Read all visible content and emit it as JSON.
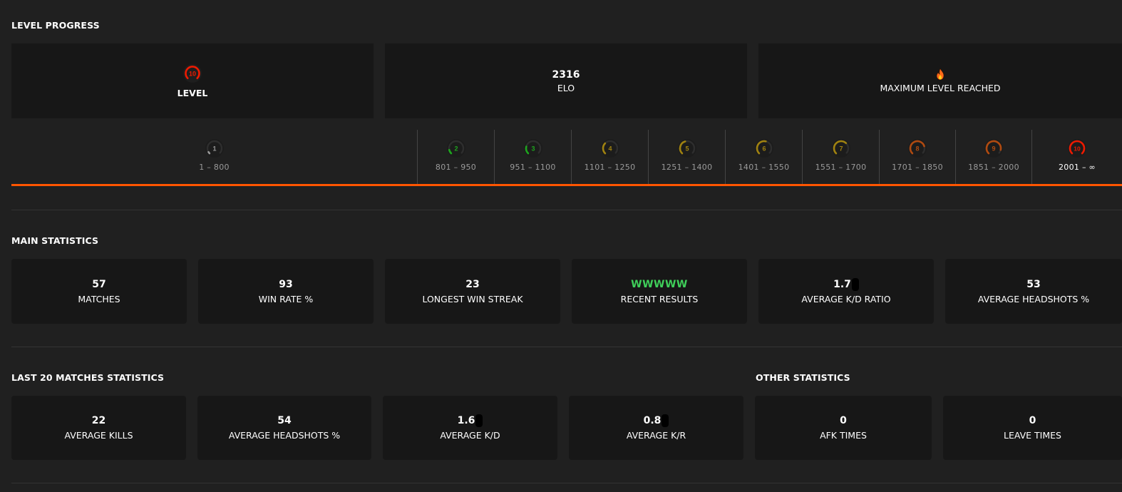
{
  "level_progress": {
    "title": "LEVEL PROGRESS",
    "level_card": {
      "level": "10",
      "label": "LEVEL"
    },
    "elo_card": {
      "value": "2316",
      "label": "ELO"
    },
    "max_card": {
      "icon": "fire-icon",
      "label": "MAXIMUM LEVEL REACHED"
    },
    "progress_fraction": 1.0,
    "accent_color": "#ff5500",
    "levels": [
      {
        "level": "1",
        "range": "1 – 800",
        "color": "#9a9a9a",
        "fill": 0.05
      },
      {
        "level": "2",
        "range": "801 – 950",
        "color": "#1ea51e",
        "fill": 0.12
      },
      {
        "level": "3",
        "range": "951 – 1100",
        "color": "#1ea51e",
        "fill": 0.22
      },
      {
        "level": "4",
        "range": "1101 – 1250",
        "color": "#a08210",
        "fill": 0.33
      },
      {
        "level": "5",
        "range": "1251 – 1400",
        "color": "#a08210",
        "fill": 0.44
      },
      {
        "level": "6",
        "range": "1401 – 1550",
        "color": "#a08210",
        "fill": 0.55
      },
      {
        "level": "7",
        "range": "1551 – 1700",
        "color": "#a08210",
        "fill": 0.66
      },
      {
        "level": "8",
        "range": "1701 – 1850",
        "color": "#b04a10",
        "fill": 0.77
      },
      {
        "level": "9",
        "range": "1851 – 2000",
        "color": "#b04a10",
        "fill": 0.88
      },
      {
        "level": "10",
        "range": "2001 – ∞",
        "color": "#ee1a00",
        "fill": 1.0,
        "current": true
      }
    ]
  },
  "main_statistics": {
    "title": "MAIN STATISTICS",
    "cards": [
      {
        "value": "57",
        "label": "MATCHES"
      },
      {
        "value": "93",
        "label": "WIN RATE %"
      },
      {
        "value": "23",
        "label": "LONGEST WIN STREAK"
      },
      {
        "value": "WWWWW",
        "label": "RECENT RESULTS",
        "color": "#3fcf5a"
      },
      {
        "value": "1.7",
        "label": "AVERAGE K/D RATIO",
        "redacted": true
      },
      {
        "value": "53",
        "label": "AVERAGE HEADSHOTS %"
      }
    ]
  },
  "last20_statistics": {
    "title": "LAST 20 MATCHES STATISTICS",
    "cards": [
      {
        "value": "22",
        "label": "AVERAGE KILLS"
      },
      {
        "value": "54",
        "label": "AVERAGE HEADSHOTS %"
      },
      {
        "value": "1.6",
        "label": "AVERAGE K/D",
        "redacted": true
      },
      {
        "value": "0.8",
        "label": "AVERAGE K/R",
        "redacted": true
      }
    ]
  },
  "other_statistics": {
    "title": "OTHER STATISTICS",
    "cards": [
      {
        "value": "0",
        "label": "AFK TIMES"
      },
      {
        "value": "0",
        "label": "LEAVE TIMES"
      }
    ]
  }
}
